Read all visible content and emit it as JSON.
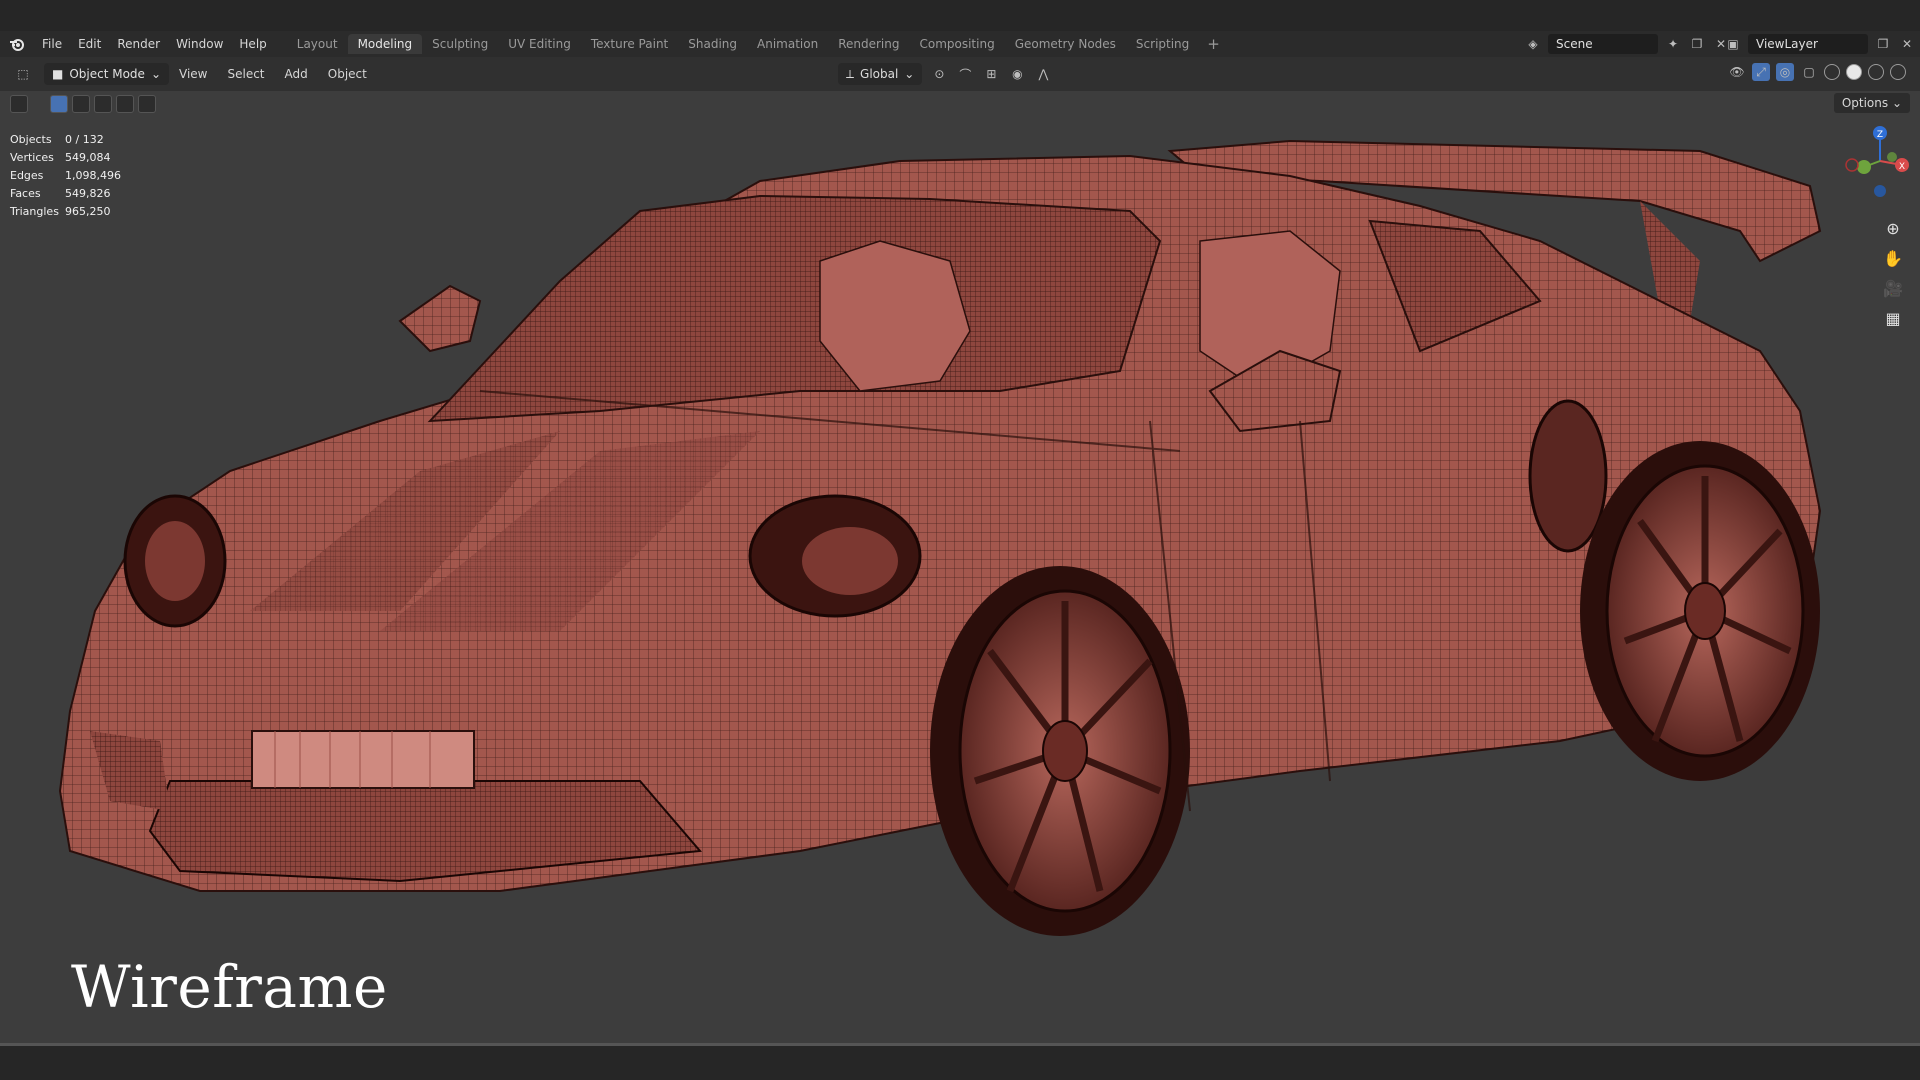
{
  "menubar": {
    "items": [
      "File",
      "Edit",
      "Render",
      "Window",
      "Help"
    ],
    "workspaces": [
      "Layout",
      "Modeling",
      "Sculpting",
      "UV Editing",
      "Texture Paint",
      "Shading",
      "Animation",
      "Rendering",
      "Compositing",
      "Geometry Nodes",
      "Scripting"
    ],
    "active_workspace": "Modeling",
    "add_label": "+",
    "scene_name": "Scene",
    "view_layer": "ViewLayer"
  },
  "header": {
    "mode": "Object Mode",
    "menus": [
      "View",
      "Select",
      "Add",
      "Object"
    ],
    "transform_orientation": "Global",
    "options_label": "Options"
  },
  "stats": [
    {
      "label": "Objects",
      "value": "0 / 132"
    },
    {
      "label": "Vertices",
      "value": "549,084"
    },
    {
      "label": "Edges",
      "value": "1,098,496"
    },
    {
      "label": "Faces",
      "value": "549,826"
    },
    {
      "label": "Triangles",
      "value": "965,250"
    }
  ],
  "gizmo": {
    "x": "X",
    "y": "Y",
    "z": "Z"
  },
  "caption": "Wireframe",
  "colors": {
    "viewport_bg": "#3d3d3d",
    "mesh_fill": "#a0554c",
    "wire": "#2a0f0c",
    "accent": "#4772b3"
  },
  "icons": [
    "blender-logo-icon",
    "zoom-icon",
    "hand-icon",
    "camera-icon",
    "grid-icon"
  ]
}
